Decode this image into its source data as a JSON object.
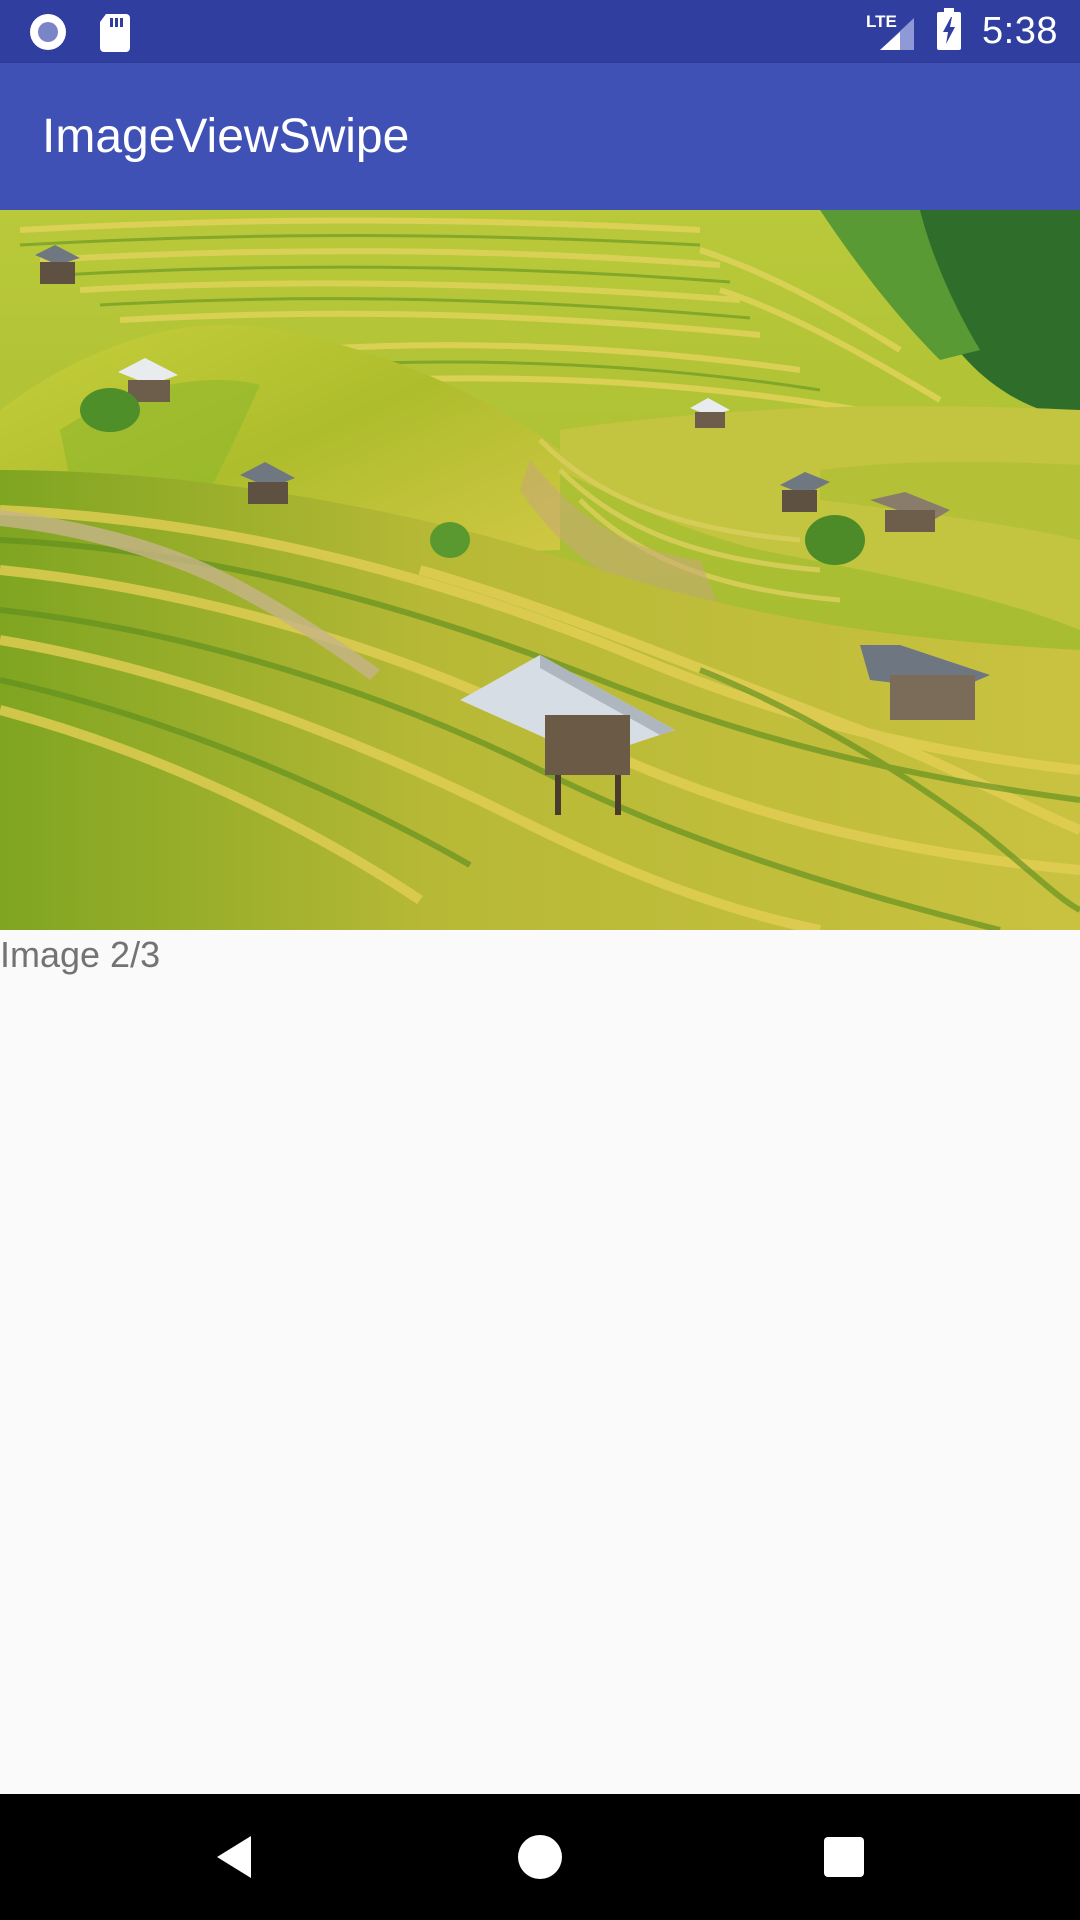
{
  "status_bar": {
    "time": "5:38",
    "network_label": "LTE",
    "icons": [
      "notification-circle-icon",
      "sd-card-icon",
      "lte-signal-icon",
      "battery-charging-icon"
    ]
  },
  "app_bar": {
    "title": "ImageViewSwipe"
  },
  "content": {
    "image_caption": "Image 2/3",
    "image_subject": "rice-terraces-photo"
  },
  "nav_bar": {
    "icons": [
      "back-icon",
      "home-icon",
      "recents-icon"
    ]
  },
  "colors": {
    "status_bar": "#303f9f",
    "app_bar": "#3f51b5",
    "background": "#fafafa",
    "caption_text": "#737373",
    "nav_bar": "#000000"
  }
}
